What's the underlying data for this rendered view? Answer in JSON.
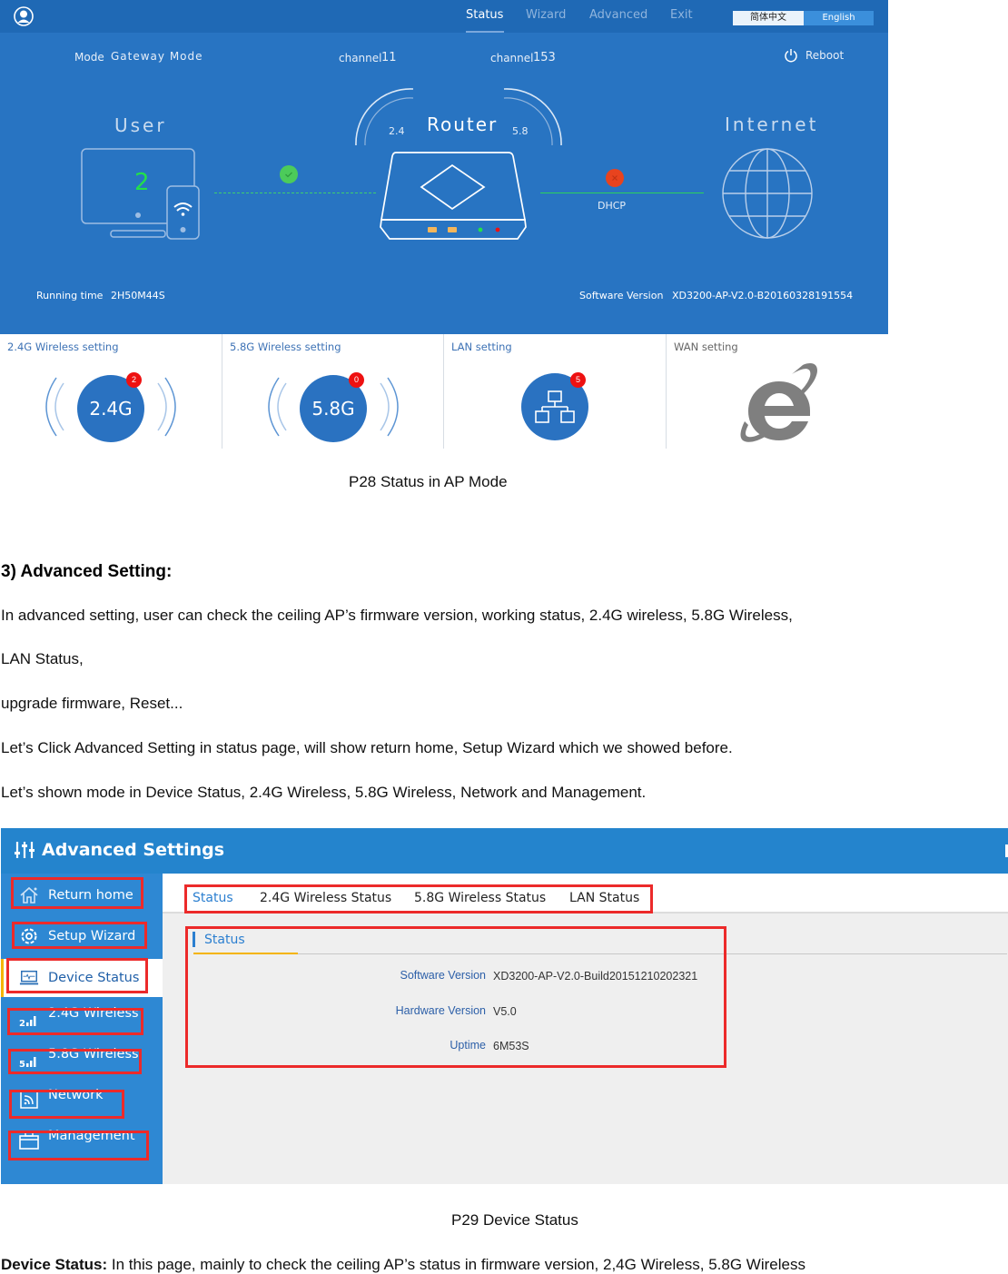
{
  "router_status": {
    "nav": {
      "items": [
        "Status",
        "Wizard",
        "Advanced",
        "Exit"
      ],
      "active": "Status"
    },
    "language": {
      "chinese": "简体中文",
      "english": "English"
    },
    "mode_label": "Mode",
    "mode_value": "Gateway Mode",
    "channel_24": {
      "label": "channel",
      "value": "11"
    },
    "channel_58": {
      "label": "channel",
      "value": "153"
    },
    "reboot_label": "Reboot",
    "user_label": "User",
    "user_count": "2",
    "router_label": "Router",
    "band_24": "2.4",
    "band_58": "5.8",
    "internet_label": "Internet",
    "wan_type": "DHCP",
    "running_time_label": "Running time",
    "running_time_value": "2H50M44S",
    "software_version_label": "Software Version",
    "software_version_value": "XD3200-AP-V2.0-B20160328191554",
    "tiles": [
      {
        "title": "2.4G Wireless setting",
        "icon_text": "2.4G",
        "badge": "2"
      },
      {
        "title": "5.8G Wireless setting",
        "icon_text": "5.8G",
        "badge": "0"
      },
      {
        "title": "LAN setting",
        "badge": "5"
      },
      {
        "title": "WAN setting"
      }
    ],
    "colors": {
      "primary": "#2874c2",
      "top_bar": "#1f69b5",
      "ok": "#4ccb5a",
      "error": "#e8431e",
      "badge": "#ee1111"
    }
  },
  "doc": {
    "caption_p28": "P28 Status in AP Mode",
    "heading": "3) Advanced Setting:",
    "lines": [
      "In advanced setting, user can check the ceiling AP’s firmware version, working status, 2.4G wireless, 5.8G Wireless,",
      "LAN Status,",
      "upgrade firmware, Reset...",
      "Let’s Click Advanced Setting in status page, will show return home, Setup Wizard which we showed before.",
      "Let’s shown mode in Device Status, 2.4G Wireless, 5.8G Wireless, Network and Management."
    ],
    "caption_p29": "P29 Device Status",
    "final_bold": "Device Status:",
    "final_text": " In this page, mainly to check the ceiling AP’s status in firmware version, 2,4G Wireless, 5.8G Wireless"
  },
  "advanced": {
    "title": "Advanced Settings",
    "sidebar": [
      {
        "label": "Return home",
        "icon": "home-icon"
      },
      {
        "label": "Setup Wizard",
        "icon": "gear-icon"
      },
      {
        "label": "Device Status",
        "icon": "monitor-pulse-icon",
        "active": true
      },
      {
        "label": "2.4G Wireless",
        "icon": "signal-24-icon"
      },
      {
        "label": "5.8G Wireless",
        "icon": "signal-58-icon"
      },
      {
        "label": "Network",
        "icon": "network-icon"
      },
      {
        "label": "Management",
        "icon": "toolbox-icon"
      }
    ],
    "tabs": [
      "Status",
      "2.4G Wireless Status",
      "5.8G Wireless Status",
      "LAN Status"
    ],
    "section_title": "Status",
    "fields": [
      {
        "label": "Software Version",
        "value": "XD3200-AP-V2.0-Build20151210202321"
      },
      {
        "label": "Hardware Version",
        "value": "V5.0"
      },
      {
        "label": "Uptime",
        "value": "6M53S"
      }
    ],
    "colors": {
      "header": "#2484cd",
      "sidebar": "#2e88d3",
      "highlight_box": "#ec2a2a",
      "active_tab": "#2b7fd0",
      "accent": "#f4b400"
    }
  }
}
